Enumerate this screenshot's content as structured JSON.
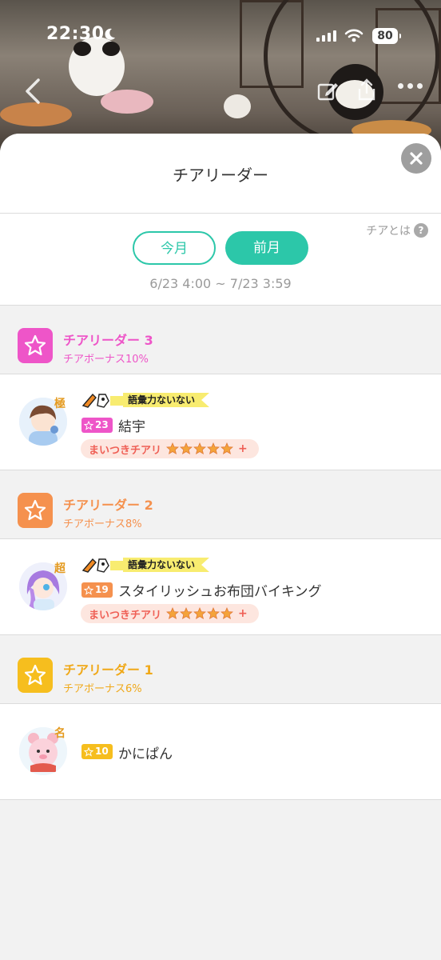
{
  "status_bar": {
    "time": "22:30",
    "battery": "80"
  },
  "sheet": {
    "title": "チアリーダー",
    "help_label": "チアとは",
    "help_icon": "?",
    "tabs": [
      {
        "label": "今月",
        "active": false
      },
      {
        "label": "前月",
        "active": true
      }
    ],
    "period_range": "6/23 4:00 ~ 7/23 3:59"
  },
  "tiers": [
    {
      "name": "チアリーダー 3",
      "bonus": "チアボーナス10%",
      "color": "#ee55c8",
      "user": {
        "avatar_tag": "極",
        "has_title": true,
        "title": "語彙力ないない",
        "level": "23",
        "name": "結宇",
        "cheer_label": "まいつきチアリ",
        "cheer_stars": 5,
        "cheer_plus": "+"
      }
    },
    {
      "name": "チアリーダー 2",
      "bonus": "チアボーナス8%",
      "color": "#f5914e",
      "user": {
        "avatar_tag": "超",
        "has_title": true,
        "title": "語彙力ないない",
        "level": "19",
        "name": "スタイリッシュお布団バイキング",
        "cheer_label": "まいつきチアリ",
        "cheer_stars": 5,
        "cheer_plus": "+"
      }
    },
    {
      "name": "チアリーダー 1",
      "bonus": "チアボーナス6%",
      "color": "#f6be1e",
      "user": {
        "avatar_tag": "名",
        "has_title": false,
        "level": "10",
        "name": "かにぱん"
      }
    }
  ],
  "icons": {
    "status": [
      "moon-icon",
      "signal-icon",
      "wifi-icon",
      "battery-icon"
    ],
    "nav": [
      "back-arrow-icon",
      "edit-icon",
      "share-icon",
      "more-icon"
    ],
    "close": "close-icon",
    "tier": "star-outline-icon"
  },
  "colors": {
    "accent": "#2cc7a9",
    "tier3": "#ee55c8",
    "tier2": "#f5914e",
    "tier1": "#f6be1e",
    "cheer_text": "#ef5f55"
  }
}
